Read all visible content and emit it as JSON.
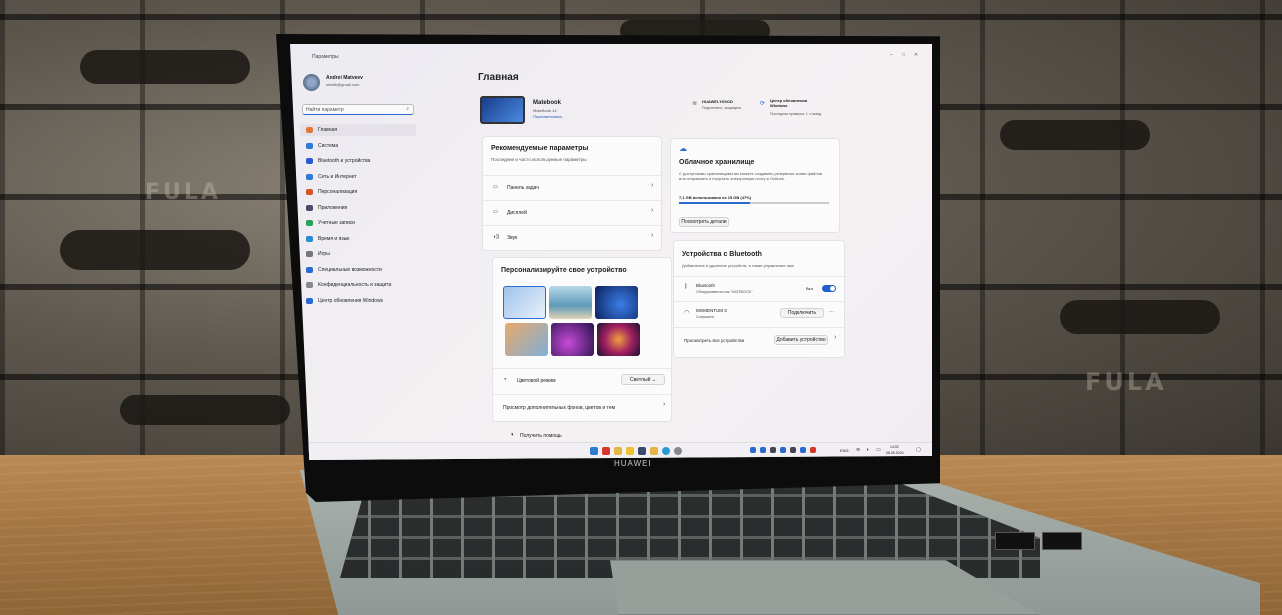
{
  "window": {
    "title": "Параметры",
    "controls": [
      "–",
      "□",
      "✕"
    ]
  },
  "user": {
    "name": "Andrei Matveev",
    "email": "srtebb@gmail.com"
  },
  "search": {
    "placeholder": "Найти параметр"
  },
  "nav": {
    "items": [
      {
        "label": "Главная",
        "icon": "home-icon",
        "color": "#e07a3a",
        "selected": true
      },
      {
        "label": "Система",
        "icon": "monitor-icon",
        "color": "#2a7bd1"
      },
      {
        "label": "Bluetooth и устройства",
        "icon": "bluetooth-icon",
        "color": "#2a5bd1"
      },
      {
        "label": "Сеть и Интернет",
        "icon": "wifi-icon",
        "color": "#2a7bd1"
      },
      {
        "label": "Персонализация",
        "icon": "brush-icon",
        "color": "#d1552a"
      },
      {
        "label": "Приложения",
        "icon": "apps-icon",
        "color": "#4a4a6a"
      },
      {
        "label": "Учетные записи",
        "icon": "person-icon",
        "color": "#2aa15a"
      },
      {
        "label": "Время и язык",
        "icon": "globe-icon",
        "color": "#2a8bd1"
      },
      {
        "label": "Игры",
        "icon": "gamepad-icon",
        "color": "#777"
      },
      {
        "label": "Специальные возможности",
        "icon": "accessibility-icon",
        "color": "#2a6bd1"
      },
      {
        "label": "Конфиденциальность и защита",
        "icon": "shield-icon",
        "color": "#888"
      },
      {
        "label": "Центр обновления Windows",
        "icon": "update-icon",
        "color": "#2a6bd1"
      }
    ]
  },
  "main": {
    "title": "Главная",
    "device": {
      "name": "Matebook",
      "model": "MateBook 14",
      "action": "Переименовать"
    },
    "wifi": {
      "name": "HUAWEI-Y6SOD",
      "status": "Подключено, защищено"
    },
    "update": {
      "title": "Центр обновления Windows",
      "status": "Последняя проверка: 1 ч назад"
    },
    "recommended": {
      "title": "Рекомендуемые параметры",
      "subtitle": "Последние и часто используемые параметры",
      "items": [
        {
          "label": "Панель задач",
          "icon": "taskbar-icon"
        },
        {
          "label": "Дисплей",
          "icon": "display-icon"
        },
        {
          "label": "Звук",
          "icon": "speaker-icon"
        }
      ]
    },
    "personalize": {
      "title": "Персонализируйте свое устройство",
      "color_mode_label": "Цветовой режим",
      "color_mode_value": "Светлый",
      "more_link": "Просмотр дополнительных фонов, цветов и тем"
    },
    "cloud": {
      "title": "Облачное хранилище",
      "description": "С доступными хранилищами вы можете создавать резервные копии файлов или отправлять и получать электронную почту в Outlook.",
      "usage": "7,1 GB использовано из 15 GB (47%)",
      "usage_fraction": 0.47,
      "details_button": "Посмотреть детали"
    },
    "bluetooth": {
      "title": "Устройства с Bluetooth",
      "subtitle": "Добавление и удаление устройств, а также управление ими",
      "bt_label": "Bluetooth",
      "bt_status": "Обнаруживается как \"MATEBOOK\"",
      "bt_toggle_label": "Вкл.",
      "device_name": "MOMENTUM 3",
      "device_status": "Сопряжено",
      "connect_button": "Подключить",
      "more_button": "···",
      "view_all": "Просмотреть все устройства",
      "add_button": "Добавить устройство"
    },
    "help": "Получить помощь"
  },
  "taskbar": {
    "lang": "ENG",
    "time": "14:02",
    "date": "06.09.2024"
  },
  "laptop": {
    "brand": "HUAWEI"
  },
  "stencil": {
    "text": "FULA"
  }
}
